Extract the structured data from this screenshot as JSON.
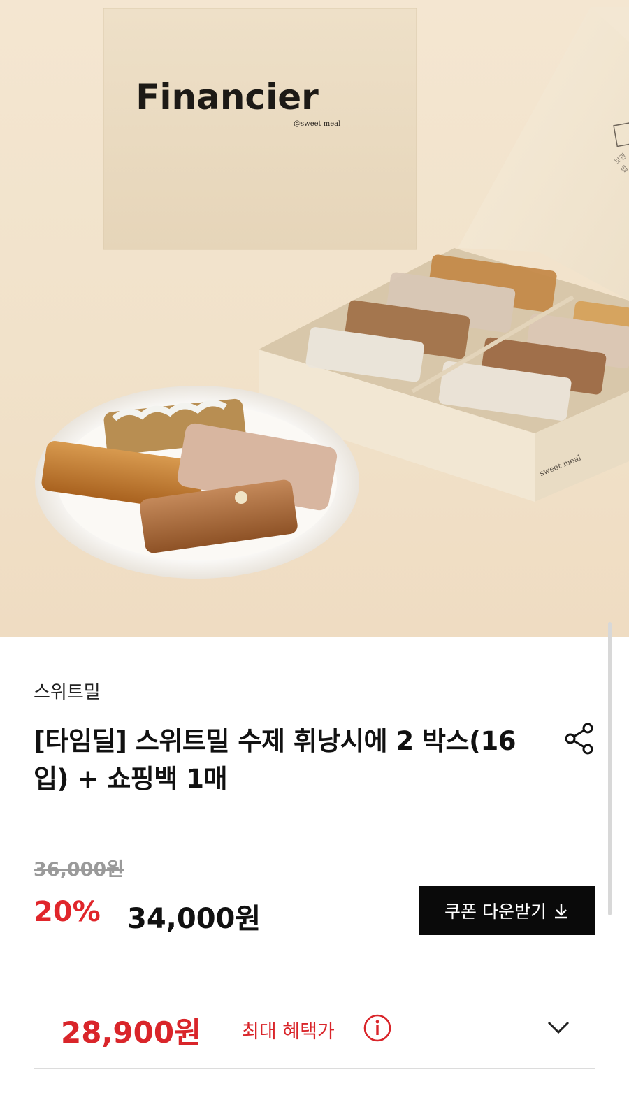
{
  "hero": {
    "box_brand": "Financier",
    "box_brand_sub": "@sweet meal",
    "box_side_label": "sweet meal",
    "box_lid_title": "보관법"
  },
  "product": {
    "brand": "스위트밀",
    "title": "[타임딜] 스위트밀 수제 휘낭시에 2 박스(16입) + 쇼핑백 1매",
    "original_price": "36,000원",
    "discount_rate": "20%",
    "sale_price": "34,000원",
    "coupon_button_label": "쿠폰 다운받기",
    "benefit_price": "28,900원",
    "benefit_label": "최대 혜택가"
  },
  "icons": {
    "share": "share-icon",
    "download": "download-arrow-icon",
    "info": "info-icon",
    "chevron": "chevron-down-icon"
  },
  "colors": {
    "accent_red": "#e0262b",
    "button_black": "#0a0a0a"
  }
}
